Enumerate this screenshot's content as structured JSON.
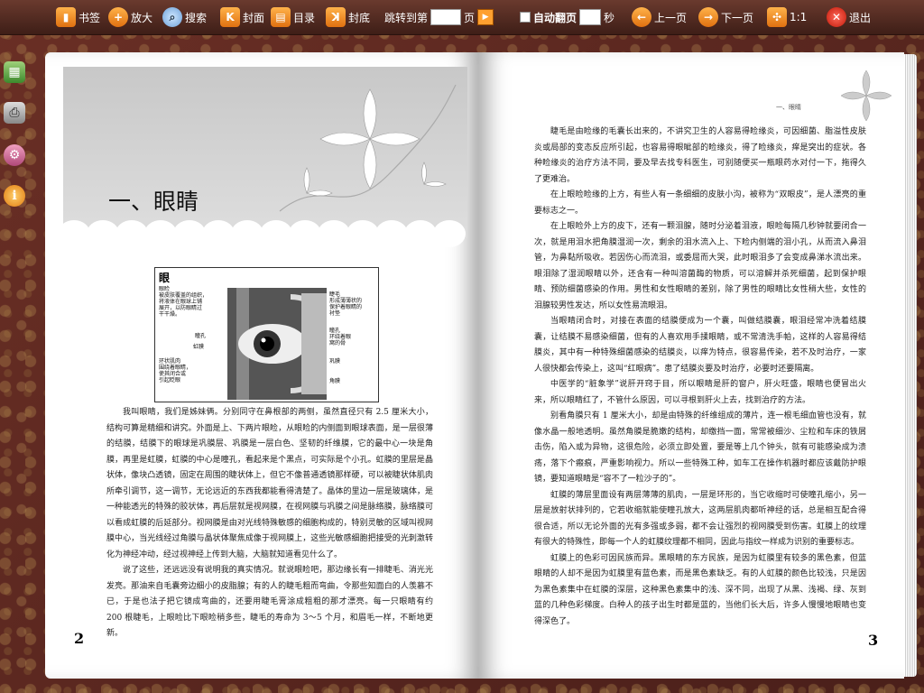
{
  "toolbar": {
    "bookmark": "书签",
    "zoom_in": "放大",
    "search": "搜索",
    "cover": "封面",
    "contents": "目录",
    "back_cover": "封底",
    "goto_prefix": "跳转到第",
    "goto_suffix": "页",
    "auto_flip": "自动翻页",
    "seconds": "秒",
    "prev": "上一页",
    "next": "下一页",
    "ratio": "1:1",
    "exit": "退出"
  },
  "left_page": {
    "chapter_title": "一、眼睛",
    "figure": {
      "title": "眼",
      "labels": {
        "eyelid": "眼睑\n被皮肤覆盖的组织，\n将液体在眼球上铺\n展开，以防眼睛过\n干干燥。",
        "pupil": "瞳孔",
        "iris": "虹膜",
        "lens": "环状肌肉\n围绕着眼睛，\n使其闭合或\n引起眨眼",
        "lashes": "睫毛\n形成薄薄状的\n保护着眼睛的\n衬垫",
        "cornea": "瞳孔\n环绕着眼\n窝的骨",
        "sclera": "巩膜",
        "tear": "角膜"
      }
    },
    "paragraphs": [
      "我叫眼睛，我们是姊妹俩。分别同守在鼻根部的两侧，虽然直径只有 2.5 厘米大小，结构可算是精细和讲究。外面是上、下两片眼睑，从眼睑的内侧面到眼球表面，是一层很薄的结膜，结膜下的眼球是巩膜层、巩膜是一层白色、坚韧的纤维膜，它的最中心一块是角膜，再里是虹膜，虹膜的中心是瞳孔，看起来是个黑点，可实际是个小孔。虹膜的里层是晶状体，像块凸透镜，固定在周围的睫状体上，但它不像普通透镜那样硬，可以被睫状体肌肉所牵引调节，这一调节，无论远近的东西我都能看得清楚了。晶体的里边一层是玻璃体，是一种能透光的特殊的胶状体，再后层就是视网膜，在视网膜与巩膜之间是脉络膜，脉络膜可以看成虹膜的后延部分。视网膜是由对光线特殊敏感的细胞构成的，特别灵敏的区域叫视网膜中心，当光线经过角膜与晶状体聚焦成像于视网膜上，这些光敏感细胞把接受的光刺激转化为神经冲动，经过视神经上传到大脑，大脑就知道看见什么了。",
      "说了这些，还远远没有说明我的真实情况。就说眼睑吧，那边缘长有一排睫毛、消光光发亮。那油来自毛囊旁边细小的皮脂腺；有的人的睫毛粗而弯曲，令那些知面白的人羡慕不已，于是也法子把它镜成弯曲的，还要用睫毛膏涂成粗粗的那才漂亮。每一只眼睛有约 200 根睫毛，上眼睑比下眼睑稍多些，睫毛的寿命为 3～5 个月，和眉毛一样，不断地更新。"
    ],
    "page_number": "2"
  },
  "right_page": {
    "running_head": "一、眼睛",
    "paragraphs": [
      "睫毛是由睑缘的毛囊长出来的，不讲究卫生的人容易得睑缘炎，可因细菌、脂溢性皮肤炎或局部的变态反应所引起，也容易得眼眦部的睑缘炎，得了睑缘炎，痒是突出的症状。各种睑缘炎的治疗方法不同，要及早去找专科医生，可别随便买一瓶眼药水对付一下，拖得久了更难治。",
      "在上眼睑睑缘的上方，有些人有一条细细的皮肤小沟，被称为“双眼皮”，是人漂亮的重要标志之一。",
      "在上眼睑外上方的皮下，还有一颗泪腺，随时分泌着泪液，眼睑每隔几秒钟就要闭合一次，就是用泪水把角膜湿润一次，剩余的泪水流入上、下睑内侧端的泪小孔，从而流入鼻泪管，为鼻黏所吸收。若因伤心而流泪，或委屈而大哭，此时眼泪多了会变成鼻涕水流出来。眼泪除了湿润眼睛以外，还含有一种叫溶菌酶的物质，可以溶解并杀死细菌，起到保护眼睛、预防细菌感染的作用。男性和女性眼睛的差别，除了男性的眼睛比女性稍大些，女性的泪腺较男性发达，所以女性易流眼泪。",
      "当眼睛闭合时，对接在表面的结膜便成为一个囊，叫做结膜囊，眼泪经常冲洗着结膜囊，让结膜不易感染细菌，但有的人喜欢用手揉眼睛，或不常清洗手帕，这样的人容易得结膜炎，其中有一种特殊细菌感染的结膜炎，以痒为特点，很容易传染，若不及时治疗，一家人很快都会传染上，这叫“红眼病”。患了结膜炎要及时治疗，必要时还要隔离。",
      "中医学的“脏象学”说肝开窍于目，所以眼睛是肝的窗户，肝火旺盛，眼睛也便冒出火来，所以眼睛红了，不管什么原因，可以寻根到肝火上去，找到治疗的方法。",
      "别看角膜只有 1 厘米大小，却是由特殊的纤维组成的薄片，连一根毛细血管也没有，就像水晶一般地透明。虽然角膜是脆嫩的结构，却缴挡一面，常常被细沙、尘粒和车床的铁屑击伤，陷入或为异物，这很危险，必须立即处置，要是等上几个钟头，就有可能感染成为溃疡，落下个瘢痕，严重影响视力。所以一些特殊工种，如车工在操作机器时都应该戴防护眼镜，要知道眼睛是“容不了一粒沙子的”。",
      "虹膜的薄层里面设有两层薄薄的肌肉，一层是环形的，当它收缩时可使瞳孔缩小，另一层是放射状排列的，它若收缩就能使瞳孔放大，这两层肌肉都听神经的话，总是相互配合得很合适，所以无论外面的光有多强或多弱，都不会让强烈的视网膜受到伤害。虹膜上的纹理有很大的特殊性，即每一个人的虹膜纹理都不相同，因此与指纹一样成为识别的重要标志。",
      "虹膜上的色彩可因民族而异。黑眼睛的东方民族，是因为虹膜里有较多的黑色素，但蓝眼睛的人却不是因为虹膜里有蓝色素，而是黑色素缺乏。有的人虹膜的颜色比较浅，只是因为黑色素集中在虹膜的深层，这种黑色素集中的浅、深不同，出现了从黑、浅褐、绿、灰到蓝的几种色彩梯度。白种人的孩子出生时都是蓝的，当他们长大后，许多人慢慢地眼睛也变得深色了。"
    ],
    "page_number": "3"
  }
}
